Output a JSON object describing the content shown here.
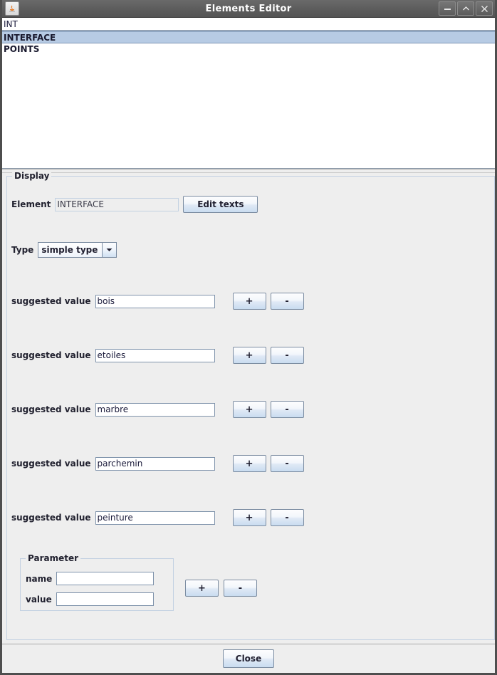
{
  "window": {
    "title": "Elements Editor",
    "app_icon": "java-coffee-icon",
    "buttons": {
      "minimize": "minimize-icon",
      "maximize": "maximize-chevron-icon",
      "close": "close-x-icon"
    }
  },
  "element_list": {
    "editor_value": "INT",
    "items": [
      {
        "label": "INTERFACE",
        "selected": true
      },
      {
        "label": "POINTS",
        "selected": false
      }
    ]
  },
  "display": {
    "legend": "Display",
    "element_label": "Element",
    "element_value": "INTERFACE",
    "edit_texts_label": "Edit texts",
    "type_label": "Type",
    "type_value": "simple type",
    "type_options": [
      "simple type"
    ],
    "suggested_label": "suggested value",
    "add_label": "+",
    "remove_label": "-",
    "suggested_values": [
      "bois",
      "etoiles",
      "marbre",
      "parchemin",
      "peinture"
    ],
    "parameter": {
      "legend": "Parameter",
      "name_label": "name",
      "name_value": "",
      "value_label": "value",
      "value_value": "",
      "add_label": "+",
      "remove_label": "-"
    }
  },
  "footer": {
    "close_label": "Close"
  },
  "colors": {
    "titlebar": "#5d5d5d",
    "selection": "#b7cbe4",
    "panel": "#eeeeee",
    "field_border": "#7f93ab",
    "group_border": "#c3d1e2"
  }
}
